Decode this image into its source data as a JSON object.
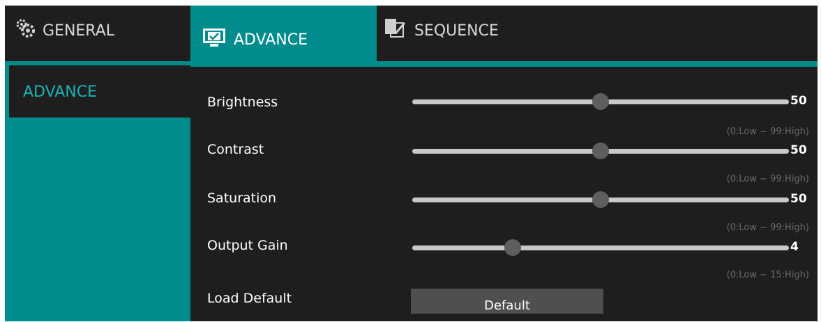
{
  "tabs": [
    {
      "label": "GENERAL",
      "icon": "gear-icon"
    },
    {
      "label": "ADVANCE",
      "icon": "monitor-check-icon",
      "active": true
    },
    {
      "label": "SEQUENCE",
      "icon": "sequence-check-icon"
    }
  ],
  "sidebar": {
    "items": [
      {
        "label": "ADVANCE",
        "selected": true
      }
    ]
  },
  "settings": [
    {
      "label": "Brightness",
      "value": "50",
      "level": 0.5,
      "range": "(0:Low ~ 99:High)"
    },
    {
      "label": "Contrast",
      "value": "50",
      "level": 0.5,
      "range": "(0:Low ~ 99:High)"
    },
    {
      "label": "Saturation",
      "value": "50",
      "level": 0.5,
      "range": "(0:Low ~ 99:High)"
    },
    {
      "label": "Output Gain",
      "value": "4",
      "level": 0.2667,
      "range": "(0:Low ~ 15:High)"
    }
  ],
  "load_default": {
    "label": "Load Default",
    "button_label": "Default"
  },
  "colors": {
    "accent": "#008c8c",
    "background": "#1e1e1e",
    "sidebar_text": "#19b3b3",
    "button": "#4f4f4f"
  }
}
